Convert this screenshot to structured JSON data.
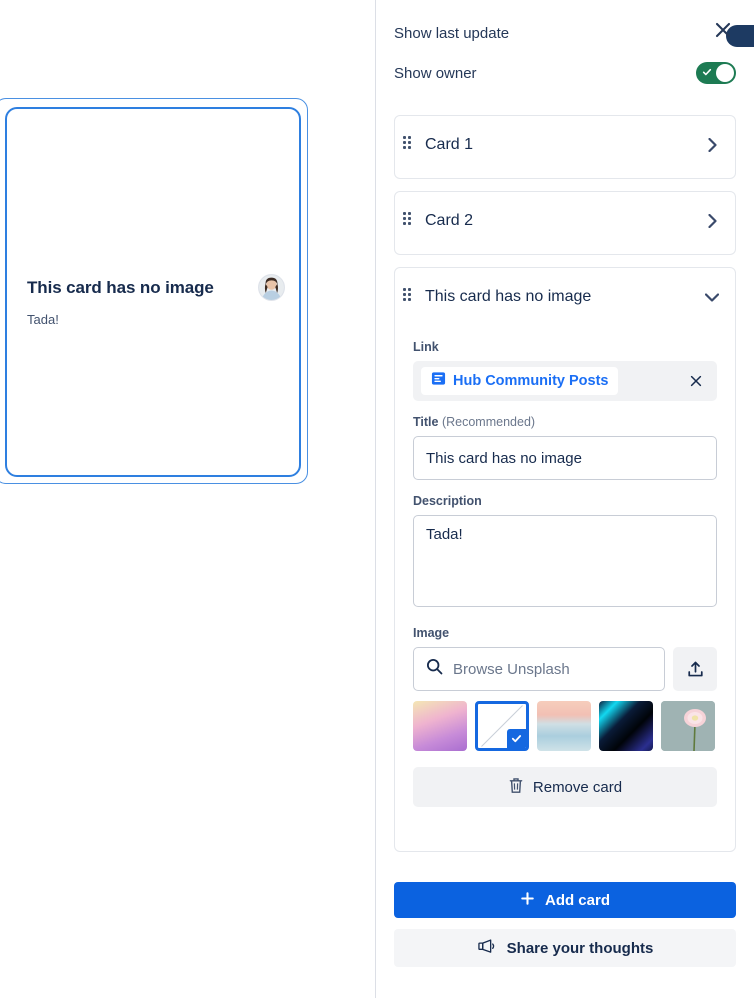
{
  "preview": {
    "card_title": "This card has no image",
    "card_description": "Tada!",
    "avatar_name": "owner-avatar"
  },
  "panel": {
    "settings": [
      {
        "label": "Show last update",
        "state": "on"
      },
      {
        "label": "Show owner",
        "state": "on"
      }
    ],
    "close_label": "×",
    "cards": [
      {
        "title": "Card 1",
        "expanded": false
      },
      {
        "title": "Card 2",
        "expanded": false
      },
      {
        "title": "This card has no image",
        "expanded": true
      }
    ],
    "expanded_card": {
      "link": {
        "label": "Link",
        "chip_text": "Hub Community Posts",
        "remove_label": "×"
      },
      "title": {
        "label": "Title",
        "label_suffix": "(Recommended)",
        "value": "This card has no image"
      },
      "description": {
        "label": "Description",
        "value": "Tada!"
      },
      "image": {
        "label": "Image",
        "search_placeholder": "Browse Unsplash",
        "upload_label": "upload-icon",
        "thumbnails": [
          {
            "name": "gradient-pink-purple",
            "selected": false
          },
          {
            "name": "no-image-tile",
            "selected": true
          },
          {
            "name": "beach-sunset-photo",
            "selected": false
          },
          {
            "name": "dark-blue-gradient",
            "selected": false
          },
          {
            "name": "pink-flower-photo",
            "selected": false
          }
        ]
      },
      "remove_card_label": "Remove card"
    },
    "add_card_label": "Add card",
    "add_card_icon": "+",
    "share_label": "Share your thoughts"
  },
  "colors": {
    "primary_blue": "#0b62e0",
    "link_blue": "#1b6ff5",
    "toggle_green": "#1d7b53",
    "text_navy": "#172b4d",
    "panel_grey": "#f1f2f4"
  }
}
